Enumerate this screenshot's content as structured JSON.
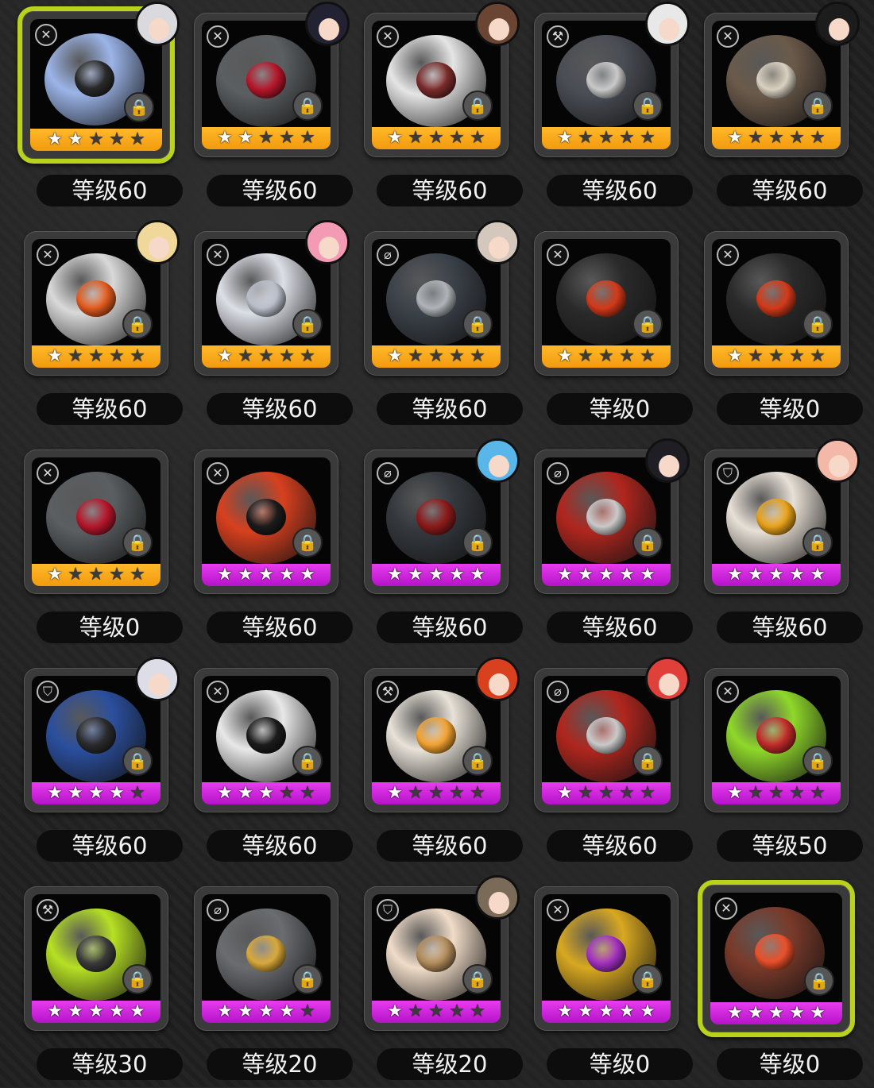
{
  "items": [
    {
      "level": "等级60",
      "stars": 2,
      "bar": "gold",
      "selected": true,
      "avatar": true,
      "hair": "#d9d9de",
      "type": "✕",
      "ball": "#9bb4e8",
      "core": "#2a2a2a"
    },
    {
      "level": "等级60",
      "stars": 2,
      "bar": "gold",
      "selected": false,
      "avatar": true,
      "hair": "#222233",
      "type": "✕",
      "ball": "#5b5f62",
      "core": "#b5162a"
    },
    {
      "level": "等级60",
      "stars": 1,
      "bar": "gold",
      "selected": false,
      "avatar": true,
      "hair": "#6b4533",
      "type": "✕",
      "ball": "#e5e5e5",
      "core": "#7a2b2b"
    },
    {
      "level": "等级60",
      "stars": 1,
      "bar": "gold",
      "selected": false,
      "avatar": true,
      "hair": "#e8e8e8",
      "type": "⚒",
      "ball": "#4a4d55",
      "core": "#c9c9c9"
    },
    {
      "level": "等级60",
      "stars": 1,
      "bar": "gold",
      "selected": false,
      "avatar": true,
      "hair": "#1c1c1c",
      "type": "✕",
      "ball": "#6b5a4a",
      "core": "#d8d0c0"
    },
    {
      "level": "等级60",
      "stars": 1,
      "bar": "gold",
      "selected": false,
      "avatar": true,
      "hair": "#f0d79a",
      "type": "✕",
      "ball": "#d9d9d9",
      "core": "#e05a1e"
    },
    {
      "level": "等级60",
      "stars": 1,
      "bar": "gold",
      "selected": false,
      "avatar": true,
      "hair": "#f39bb4",
      "type": "✕",
      "ball": "#dcdfe6",
      "core": "#b8bdc8"
    },
    {
      "level": "等级60",
      "stars": 1,
      "bar": "gold",
      "selected": false,
      "avatar": true,
      "hair": "#d4c8bc",
      "type": "⌀",
      "ball": "#3c424a",
      "core": "#b0b4b8"
    },
    {
      "level": "等级0",
      "stars": 1,
      "bar": "gold",
      "selected": false,
      "avatar": false,
      "hair": "",
      "type": "✕",
      "ball": "#2a2a2a",
      "core": "#d33a1a"
    },
    {
      "level": "等级0",
      "stars": 1,
      "bar": "gold",
      "selected": false,
      "avatar": false,
      "hair": "",
      "type": "✕",
      "ball": "#2a2a2a",
      "core": "#d33a1a"
    },
    {
      "level": "等级0",
      "stars": 1,
      "bar": "gold",
      "selected": false,
      "avatar": false,
      "hair": "",
      "type": "✕",
      "ball": "#5b5f62",
      "core": "#b5162a"
    },
    {
      "level": "等级60",
      "stars": 5,
      "bar": "purple",
      "selected": false,
      "avatar": false,
      "hair": "",
      "type": "✕",
      "ball": "#d8401e",
      "core": "#1b1b1b"
    },
    {
      "level": "等级60",
      "stars": 5,
      "bar": "purple",
      "selected": false,
      "avatar": true,
      "hair": "#59b6e8",
      "type": "⌀",
      "ball": "#34383d",
      "core": "#8b1a1a"
    },
    {
      "level": "等级60",
      "stars": 5,
      "bar": "purple",
      "selected": false,
      "avatar": true,
      "hair": "#1e1e24",
      "type": "⌀",
      "ball": "#b0261e",
      "core": "#c9c9c9"
    },
    {
      "level": "等级60",
      "stars": 5,
      "bar": "purple",
      "selected": false,
      "avatar": true,
      "hair": "#f3b8a8",
      "type": "⛉",
      "ball": "#e8e0d6",
      "core": "#e5a01a"
    },
    {
      "level": "等级60",
      "stars": 4,
      "bar": "purple",
      "selected": false,
      "avatar": true,
      "hair": "#dcdde6",
      "type": "⛉",
      "ball": "#2b4f9e",
      "core": "#2a2a2a"
    },
    {
      "level": "等级60",
      "stars": 3,
      "bar": "purple",
      "selected": false,
      "avatar": false,
      "hair": "",
      "type": "✕",
      "ball": "#e8e8e8",
      "core": "#1b1b1b"
    },
    {
      "level": "等级60",
      "stars": 1,
      "bar": "purple",
      "selected": false,
      "avatar": true,
      "hair": "#d8401e",
      "type": "⚒",
      "ball": "#e8e2d8",
      "core": "#f0a030"
    },
    {
      "level": "等级60",
      "stars": 1,
      "bar": "purple",
      "selected": false,
      "avatar": true,
      "hair": "#e0403a",
      "type": "⌀",
      "ball": "#b0261e",
      "core": "#c9c9c9"
    },
    {
      "level": "等级50",
      "stars": 1,
      "bar": "purple",
      "selected": false,
      "avatar": false,
      "hair": "",
      "type": "✕",
      "ball": "#8fd82a",
      "core": "#c02a2a"
    },
    {
      "level": "等级30",
      "stars": 5,
      "bar": "purple",
      "selected": false,
      "avatar": false,
      "hair": "",
      "type": "⚒",
      "ball": "#b6e024",
      "core": "#3a3a3a"
    },
    {
      "level": "等级20",
      "stars": 4,
      "bar": "purple",
      "selected": false,
      "avatar": false,
      "hair": "",
      "type": "⌀",
      "ball": "#6a6c70",
      "core": "#d8a83a"
    },
    {
      "level": "等级20",
      "stars": 1,
      "bar": "purple",
      "selected": false,
      "avatar": true,
      "hair": "#7a6a58",
      "type": "⛉",
      "ball": "#f0dcc8",
      "core": "#b08a5a"
    },
    {
      "level": "等级0",
      "stars": 5,
      "bar": "purple",
      "selected": false,
      "avatar": false,
      "hair": "",
      "type": "✕",
      "ball": "#d8a820",
      "core": "#a030c0"
    },
    {
      "level": "等级0",
      "stars": 5,
      "bar": "purple",
      "selected": true,
      "avatar": false,
      "hair": "",
      "type": "✕",
      "ball": "#7a3a2a",
      "core": "#e8502a"
    }
  ]
}
